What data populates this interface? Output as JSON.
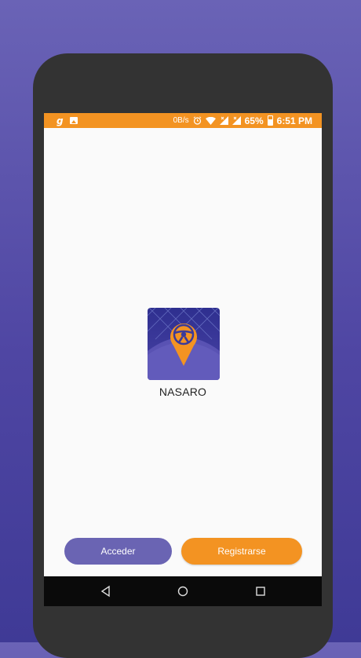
{
  "status_bar": {
    "app_icon": "g-icon",
    "image_icon": "image-icon",
    "network_speed": "0B/s",
    "battery_percent": "65%",
    "time": "6:51 PM"
  },
  "logo": {
    "title": "NASARO",
    "colors": {
      "background": "#3c3b9c",
      "pin": "#f39322"
    }
  },
  "buttons": {
    "login_label": "Acceder",
    "register_label": "Registrarse"
  },
  "nav_bar": {
    "back": "back-icon",
    "home": "home-icon",
    "recents": "recents-icon"
  },
  "colors": {
    "accent_orange": "#f39322",
    "accent_purple": "#6a64b3",
    "page_background": "#5a54ab"
  }
}
